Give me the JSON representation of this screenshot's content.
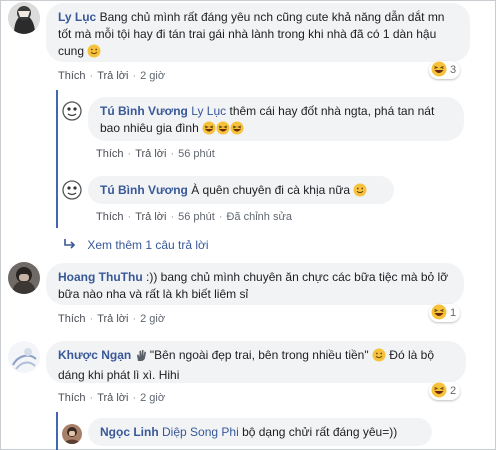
{
  "comments": [
    {
      "name": "Ly Lục",
      "text": "Bang chủ mình rất đáng yêu nch cũng cute khả năng dẫn dắt mn tốt mà mỗi tội hay đi tán trai gái nhà lành trong khi nhà đã có 1 dàn hậu cung",
      "like": "Thích",
      "reply": "Trả lời",
      "time": "2 giờ",
      "reactions": "3"
    },
    {
      "name": "Tú Bình Vương",
      "tag": "Ly Lục",
      "text": "thêm cái hay đốt nhà ngta, phá tan nát bao nhiêu gia đình",
      "like": "Thích",
      "reply": "Trả lời",
      "time": "56 phút"
    },
    {
      "name": "Tú Bình Vương",
      "text": "À quên chuyên đi cà khịa nữa",
      "like": "Thích",
      "reply": "Trả lời",
      "time": "56 phút",
      "edited": "Đã chỉnh sửa"
    },
    {
      "more_replies": "Xem thêm 1 câu trả lời"
    },
    {
      "name": "Hoang ThuThu",
      "text": ":)) bang chủ mình chuyên ăn chực các bữa tiệc mà bỏ lỡ bữa nào nha và rất là kh biết liêm sỉ",
      "like": "Thích",
      "reply": "Trả lời",
      "time": "2 giờ",
      "reactions": "1"
    },
    {
      "name": "Khược Ngạn",
      "text": "\"Bên ngoài đẹp trai, bên trong nhiều tiền\"",
      "text2": "Đó là bộ dáng khi phát lì xì. Hihi",
      "like": "Thích",
      "reply": "Trả lời",
      "time": "2 giờ",
      "reactions": "2"
    },
    {
      "name": "Ngọc Linh",
      "tag": "Diệp Song Phi",
      "text": "bộ dạng chửi rất đáng yêu=))"
    }
  ],
  "colors": {
    "link": "#385898",
    "bubble": "#f2f3f5",
    "thread": "#4267b2"
  }
}
